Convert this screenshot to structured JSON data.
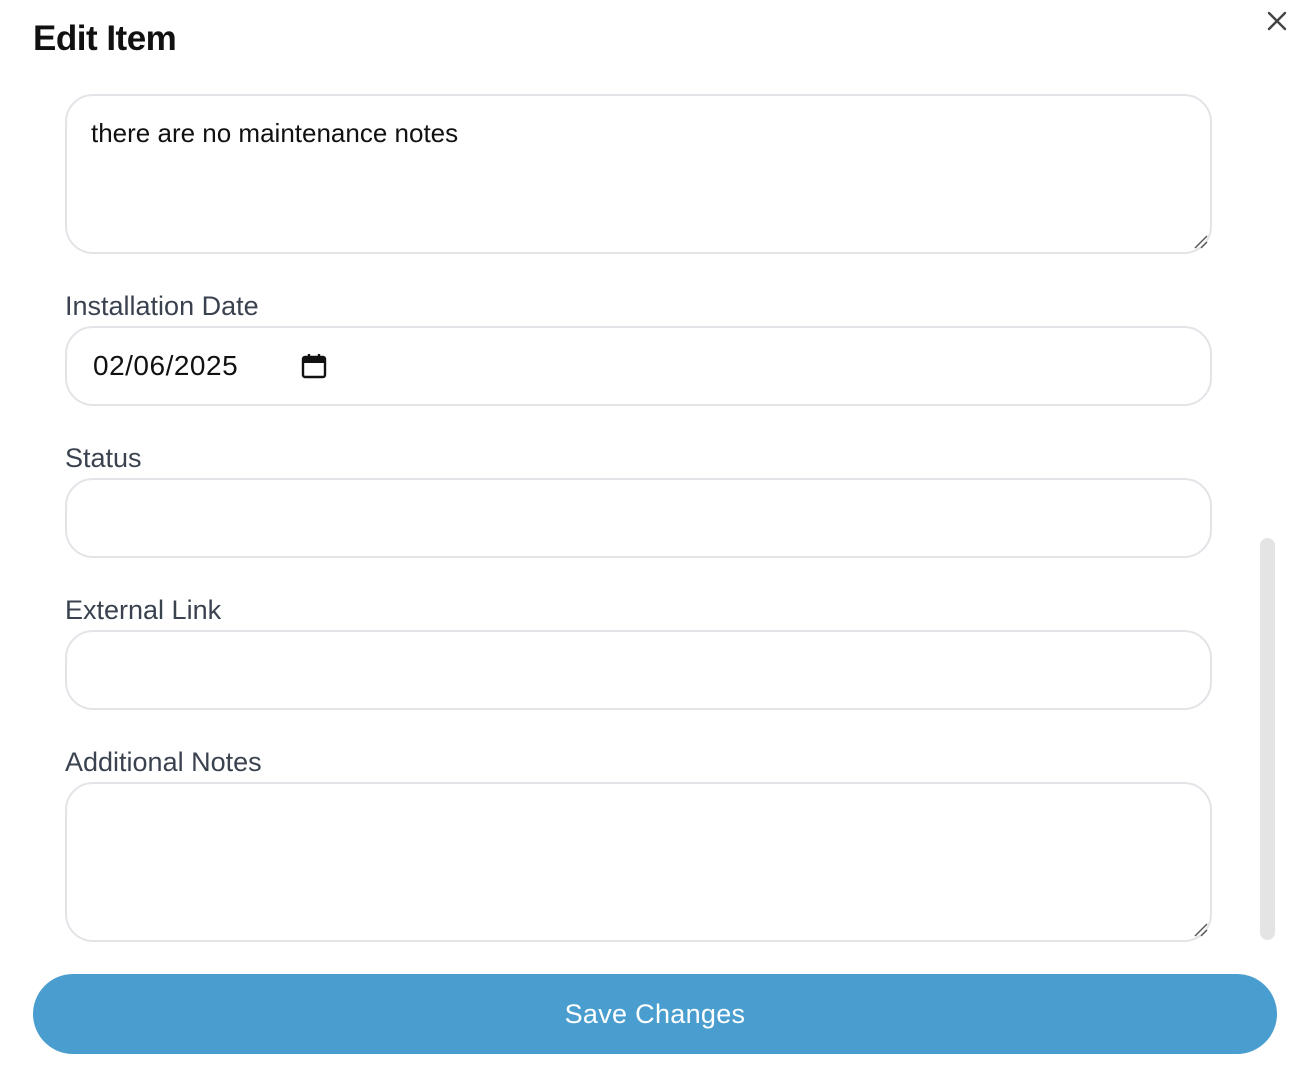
{
  "modal": {
    "title": "Edit Item",
    "close_icon": "close-icon"
  },
  "fields": {
    "maintenance_notes": {
      "value": "there are no maintenance notes"
    },
    "installation_date": {
      "label": "Installation Date",
      "value": "02/06/2025",
      "icon": "calendar-icon"
    },
    "status": {
      "label": "Status",
      "value": ""
    },
    "external_link": {
      "label": "External Link",
      "value": ""
    },
    "additional_notes": {
      "label": "Additional Notes",
      "value": ""
    }
  },
  "actions": {
    "save_label": "Save Changes"
  },
  "colors": {
    "primary_button": "#4a9ecf",
    "field_border": "#e2e4e8",
    "label_text": "#3a4250",
    "scrollbar": "#e4e4e4"
  }
}
